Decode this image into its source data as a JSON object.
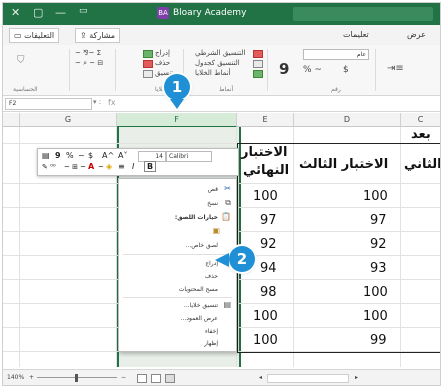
{
  "titlebar": {
    "app_title": "Bloary Academy",
    "badge": "BA"
  },
  "tabs": {
    "comments_label": "التعليقات",
    "share_label": "مشاركة",
    "help_label": "تعليمات",
    "view_label": "عرض"
  },
  "ribbon": {
    "insert": "إدراج",
    "delete": "حذف",
    "format": "تنسيق",
    "cells_group": "خلايا",
    "cond_format": "التنسيق الشرطي",
    "format_table": "التنسيق كجدول",
    "cell_styles": "أنماط الخلايا",
    "styles_group": "أنماط",
    "number_format": "عام",
    "number_group": "رقم",
    "sensitivity": "الحساسية",
    "percent": "% ~"
  },
  "formula_bar": {
    "name_box": "F2",
    "fx": "fx"
  },
  "columns": [
    "G",
    "F",
    "E",
    "D",
    "C"
  ],
  "sheet": {
    "row1_partial": "بعد",
    "header_e1": "الاختبار",
    "header_e2": "النهائي",
    "header_d": "الاختبار الثالث",
    "header_c": "ر الثاني",
    "e_values": [
      "100",
      "97",
      "92",
      "94",
      "98",
      "100",
      "100"
    ],
    "d_values": [
      "100",
      "97",
      "92",
      "93",
      "100",
      "100",
      "99"
    ]
  },
  "mini_toolbar": {
    "font_name": "Calibri",
    "font_size": "14",
    "bold": "B",
    "italic": "I",
    "align": "≡",
    "percent": "%",
    "currency": "$",
    "comma": "9",
    "grow": "A^",
    "shrink": "A˅"
  },
  "context_menu": {
    "items": [
      "قص",
      "نسخ",
      "خيارات اللصق:",
      "",
      "لصق خاص...",
      "إدراج",
      "حذف",
      "مسح المحتويات",
      "تنسيق خلايا...",
      "عرض العمود...",
      "إخفاء",
      "إظهار"
    ]
  },
  "callouts": {
    "one": "1",
    "two": "2"
  },
  "status": {
    "zoom": "140%"
  },
  "colors": {
    "excel_green": "#217346",
    "callout_blue": "#1f8fd6"
  }
}
